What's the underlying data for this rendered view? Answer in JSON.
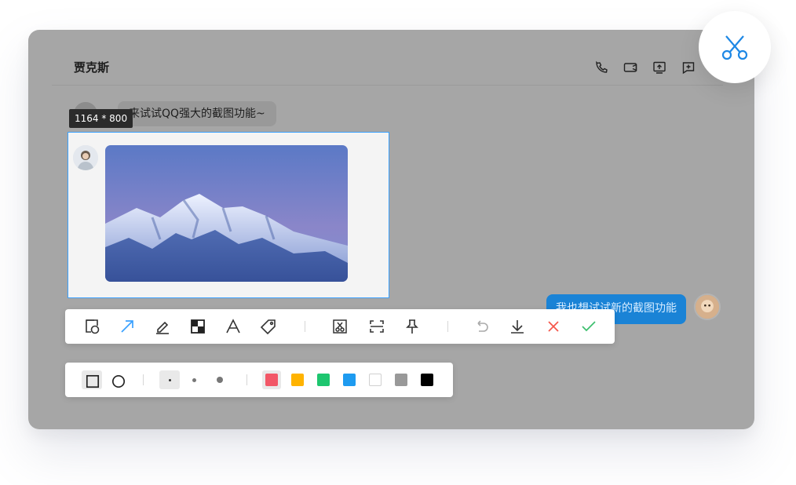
{
  "chat": {
    "title": "贾克斯",
    "messages": {
      "left_text": "来试试QQ强大的截图功能~",
      "right_text": "我也想试试新的截图功能"
    }
  },
  "screenshot": {
    "dimension_label": "1164 * 800"
  },
  "toolbar": {
    "tools": [
      "rectangle-tool",
      "arrow-tool",
      "pen-tool",
      "mosaic-tool",
      "text-tool",
      "tag-tool",
      "ocr-tool",
      "scroll-capture-tool",
      "pin-tool",
      "undo",
      "download",
      "cancel",
      "confirm"
    ],
    "accent": "#3aa1ff",
    "cancel_color": "#f5564a",
    "confirm_color": "#3dbf6e"
  },
  "subbar": {
    "shapes": [
      "square",
      "circle"
    ],
    "sizes": [
      "small",
      "medium",
      "large"
    ],
    "colors": [
      "#f25767",
      "#ffb300",
      "#1ec66f",
      "#1e9bf0",
      "#ffffff",
      "#999999",
      "#000000"
    ],
    "selected_color": "#f25767"
  },
  "theme": {
    "overlay": "#a6a6a6",
    "bubble_right": "#1a83d6",
    "fab_icon": "#1e88e5"
  }
}
